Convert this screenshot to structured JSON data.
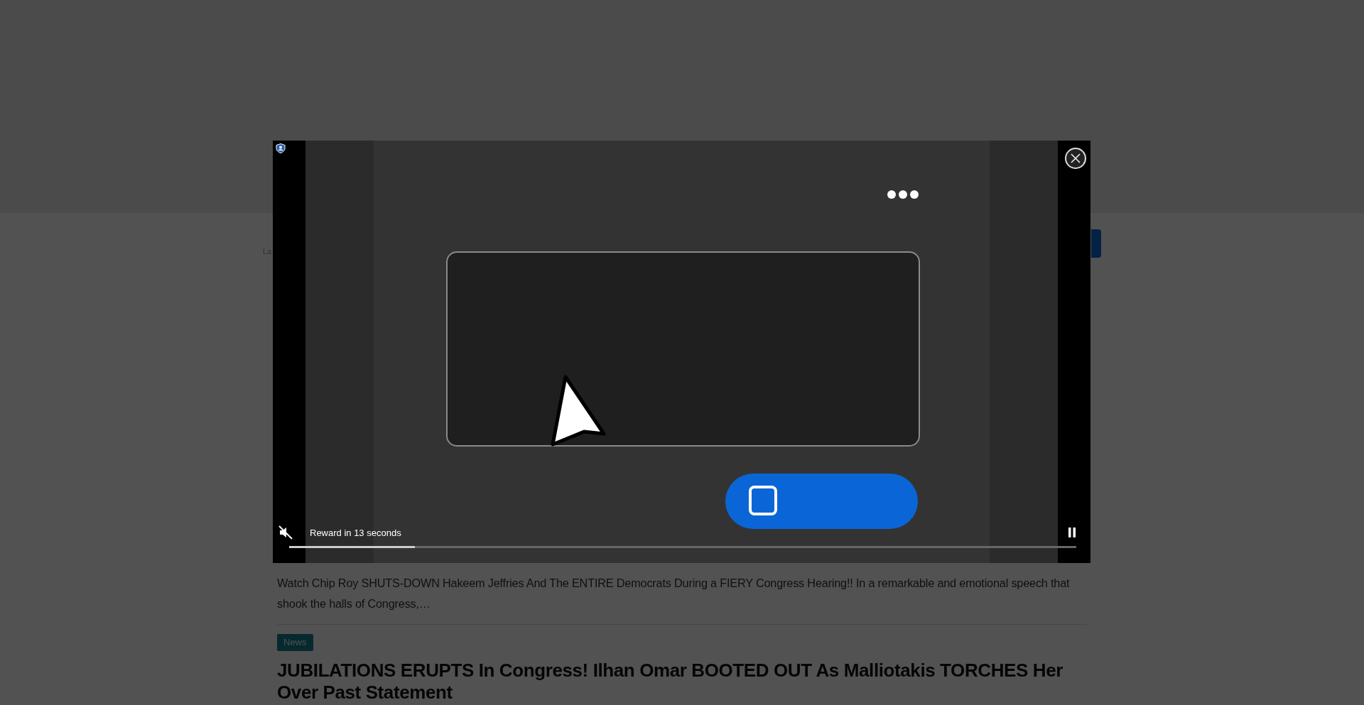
{
  "page": {
    "tagline": "La",
    "articles": [
      {
        "excerpt": "Watch Chip Roy SHUTS-DOWN Hakeem Jeffries And The ENTIRE Democrats During a FIERY Congress Hearing!! In a remarkable and emotional speech that shook the halls of Congress,…"
      },
      {
        "tag": "News",
        "headline": "JUBILATIONS ERUPTS In Congress! Ilhan Omar BOOTED OUT As Malliotakis TORCHES Her Over Past Statement"
      }
    ]
  },
  "video_ad": {
    "reward": "Reward in 13 seconds",
    "muted": true,
    "playing": true,
    "progress": {
      "level": 0.16
    }
  }
}
